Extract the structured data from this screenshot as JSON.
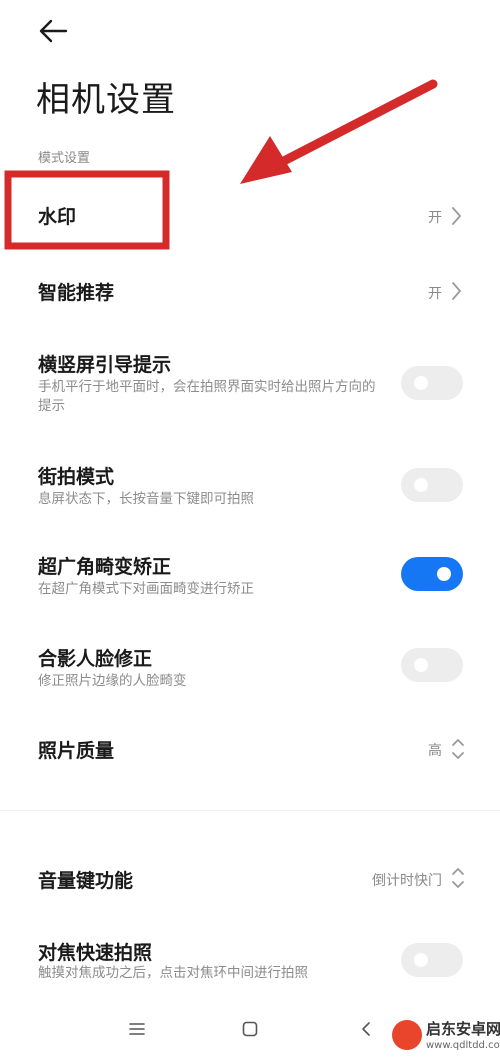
{
  "header": {
    "title": "相机设置",
    "back_icon": "arrow-left-icon"
  },
  "section": {
    "label": "模式设置"
  },
  "settings": {
    "watermark": {
      "title": "水印",
      "value": "开"
    },
    "smart_recommend": {
      "title": "智能推荐",
      "value": "开"
    },
    "orientation_guide": {
      "title": "横竖屏引导提示",
      "subtitle": "手机平行于地平面时，会在拍照界面实时给出照片方向的提示",
      "enabled": false
    },
    "street_mode": {
      "title": "街拍模式",
      "subtitle": "息屏状态下，长按音量下键即可拍照",
      "enabled": false
    },
    "ultrawide_correction": {
      "title": "超广角畸变矫正",
      "subtitle": "在超广角模式下对画面畸变进行矫正",
      "enabled": true
    },
    "group_face_correction": {
      "title": "合影人脸修正",
      "subtitle": "修正照片边缘的人脸畸变",
      "enabled": false
    },
    "photo_quality": {
      "title": "照片质量",
      "value": "高"
    },
    "volume_key": {
      "title": "音量键功能",
      "value": "倒计时快门"
    },
    "focus_shoot": {
      "title": "对焦快速拍照",
      "subtitle": "触摸对焦成功之后，点击对焦环中间进行拍照",
      "enabled": false
    }
  },
  "navbar": {
    "icons": [
      "menu-icon",
      "home-icon",
      "back-icon"
    ]
  },
  "watermark_badge": {
    "name": "启东安卓网",
    "url": "www.qdltdd.com"
  },
  "colors": {
    "accent": "#1677f5",
    "annotation_red": "#d42a2a",
    "toggle_off": "#ededed"
  }
}
